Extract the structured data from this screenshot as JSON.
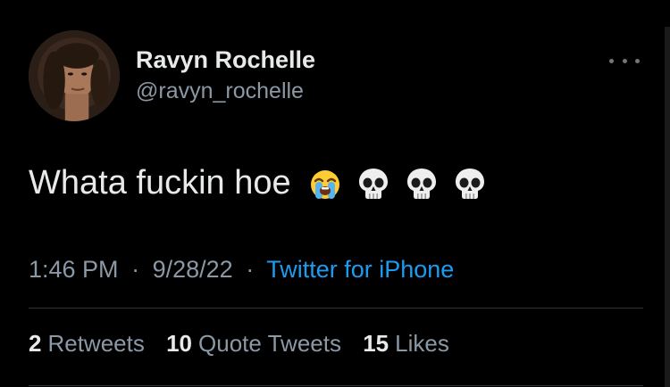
{
  "user": {
    "display_name": "Ravyn Rochelle",
    "handle": "@ravyn_rochelle"
  },
  "tweet": {
    "text": "Whata fuckin hoe",
    "emojis": [
      "loudly-crying-face",
      "skull",
      "skull",
      "skull"
    ],
    "time": "1:46 PM",
    "date": "9/28/22",
    "separator": "·",
    "source": "Twitter for iPhone"
  },
  "stats": {
    "retweets_count": "2",
    "retweets_label": "Retweets",
    "quotes_count": "10",
    "quotes_label": "Quote Tweets",
    "likes_count": "15",
    "likes_label": "Likes"
  },
  "colors": {
    "background": "#000000",
    "primary_text": "#e7e9ea",
    "secondary_text": "#8b98a5",
    "link": "#1d9bf0",
    "divider": "#2f3336"
  }
}
